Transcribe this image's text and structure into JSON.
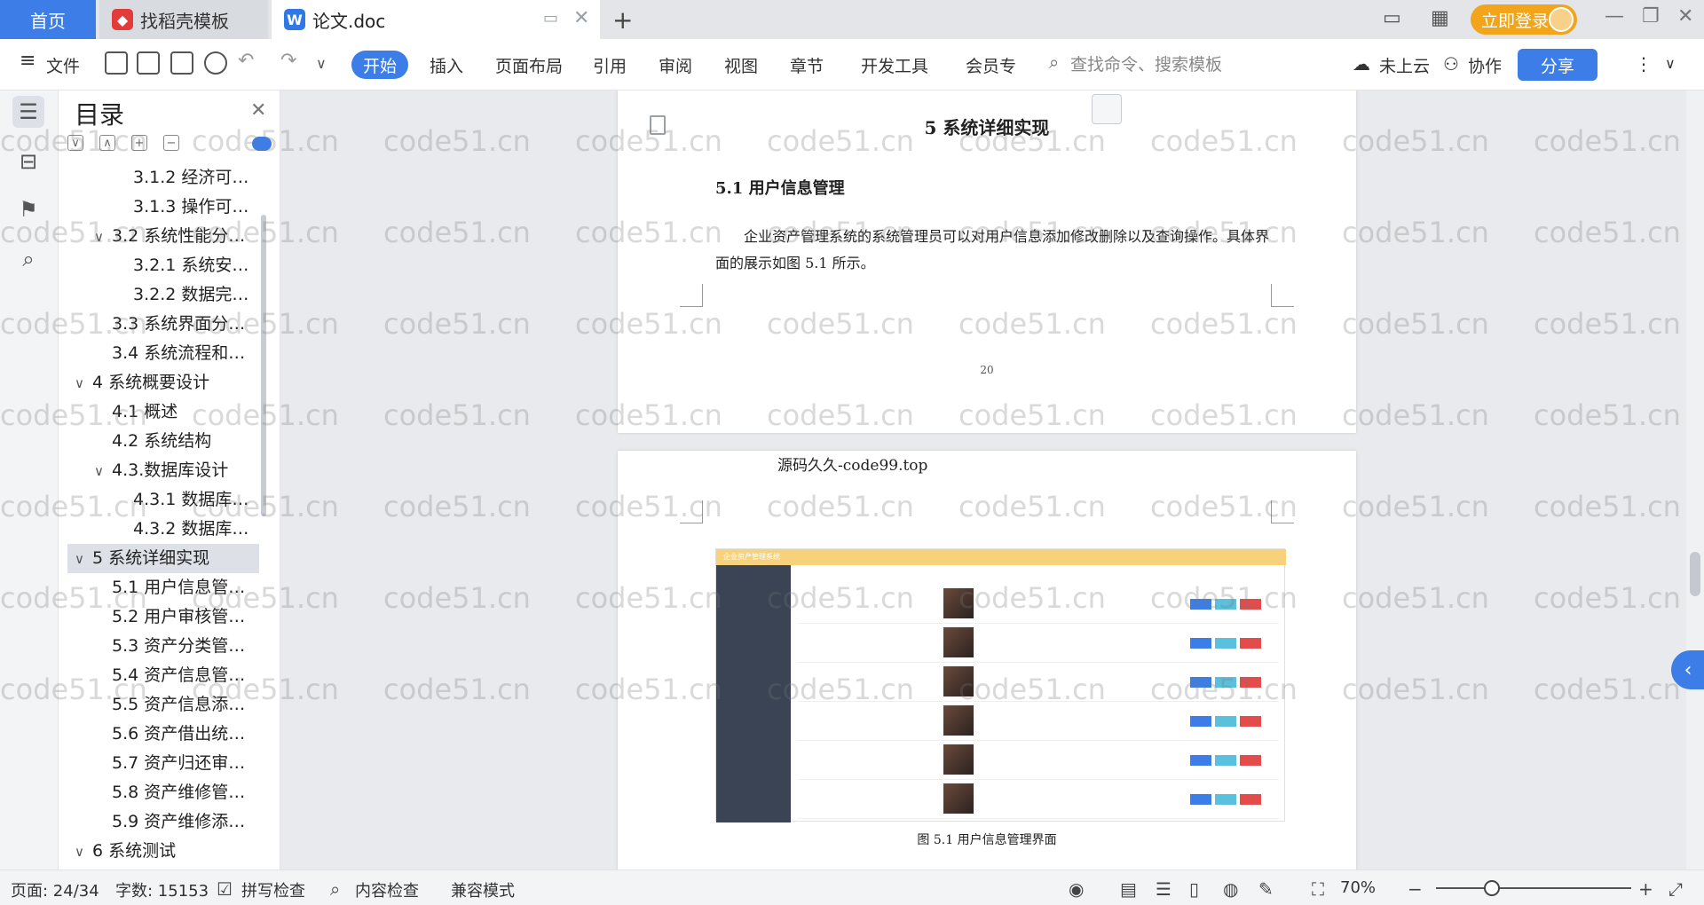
{
  "tabs": {
    "home": "首页",
    "docer": "找稻壳模板",
    "document": "论文.doc",
    "new_tab": "+"
  },
  "titlebar": {
    "login": "立即登录"
  },
  "ribbon": {
    "file_menu": "文件",
    "tabs": [
      "开始",
      "插入",
      "页面布局",
      "引用",
      "审阅",
      "视图",
      "章节",
      "开发工具",
      "会员专"
    ],
    "search_placeholder": "查找命令、搜索模板",
    "cloud_status": "未上云",
    "collaborate": "协作",
    "share": "分享"
  },
  "toc": {
    "title": "目录",
    "items": [
      {
        "label": "3.1.2 经济可…",
        "level": 3,
        "arrow": ""
      },
      {
        "label": "3.1.3 操作可…",
        "level": 3,
        "arrow": ""
      },
      {
        "label": "3.2 系统性能分…",
        "level": 2,
        "arrow": "∨"
      },
      {
        "label": "3.2.1  系统安…",
        "level": 3,
        "arrow": ""
      },
      {
        "label": "3.2.2  数据完…",
        "level": 3,
        "arrow": ""
      },
      {
        "label": "3.3 系统界面分…",
        "level": 2,
        "arrow": ""
      },
      {
        "label": "3.4 系统流程和…",
        "level": 2,
        "arrow": ""
      },
      {
        "label": "4 系统概要设计",
        "level": 1,
        "arrow": "∨"
      },
      {
        "label": "4.1 概述",
        "level": 2,
        "arrow": ""
      },
      {
        "label": "4.2 系统结构",
        "level": 2,
        "arrow": ""
      },
      {
        "label": "4.3.数据库设计",
        "level": 2,
        "arrow": "∨"
      },
      {
        "label": "4.3.1 数据库…",
        "level": 3,
        "arrow": ""
      },
      {
        "label": "4.3.2 数据库…",
        "level": 3,
        "arrow": ""
      },
      {
        "label": "5 系统详细实现",
        "level": 1,
        "arrow": "∨",
        "active": true
      },
      {
        "label": "5.1  用户信息管…",
        "level": 2,
        "arrow": ""
      },
      {
        "label": "5.2  用户审核管…",
        "level": 2,
        "arrow": ""
      },
      {
        "label": "5.3  资产分类管…",
        "level": 2,
        "arrow": ""
      },
      {
        "label": "5.4  资产信息管…",
        "level": 2,
        "arrow": ""
      },
      {
        "label": "5.5  资产信息添…",
        "level": 2,
        "arrow": ""
      },
      {
        "label": "5.6  资产借出统…",
        "level": 2,
        "arrow": ""
      },
      {
        "label": "5.7  资产归还审…",
        "level": 2,
        "arrow": ""
      },
      {
        "label": "5.8  资产维修管…",
        "level": 2,
        "arrow": ""
      },
      {
        "label": "5.9  资产维修添…",
        "level": 2,
        "arrow": ""
      },
      {
        "label": "6 系统测试",
        "level": 1,
        "arrow": "∨"
      }
    ]
  },
  "document": {
    "chapter_title": "5 系统详细实现",
    "section_title": "5.1  用户信息管理",
    "paragraph": "企业资产管理系统的系统管理员可以对用户信息添加修改删除以及查询操作。具体界面的展示如图 5.1 所示。",
    "page_number": "20",
    "page2_text": "源码久久-code99.top",
    "figure_caption": "图 5.1  用户信息管理界面",
    "figure_header": "企业资产管理系统"
  },
  "watermark": "code51.cn",
  "statusbar": {
    "page": "页面: 24/34",
    "words": "字数: 15153",
    "spell_check": "拼写检查",
    "content_check": "内容检查",
    "compat_mode": "兼容模式",
    "zoom": "70%"
  },
  "colors": {
    "accent": "#3c7de8",
    "login": "#f2a41a"
  }
}
